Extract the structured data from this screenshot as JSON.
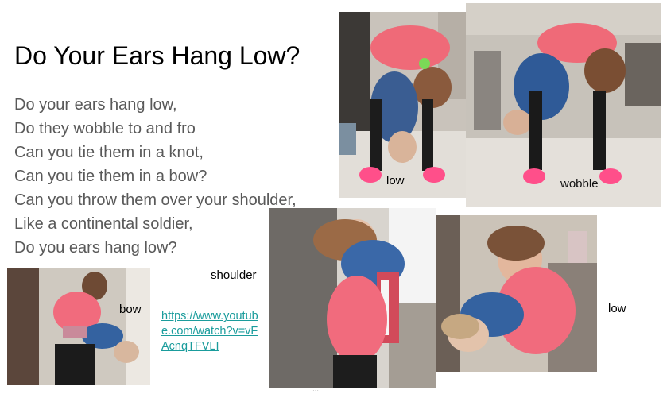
{
  "slide": {
    "title": "Do Your Ears Hang Low?",
    "lyrics": [
      "Do your ears hang low,",
      "Do they wobble to and fro",
      "Can you tie them in a knot,",
      "Can you tie them in a bow?",
      "Can you throw them over your shoulder,",
      "Like a continental soldier,",
      "Do you ears hang low?"
    ],
    "link": "https://www.youtube.com/watch?v=vFAcnqTFVLI",
    "captions": {
      "low_top": "low",
      "wobble": "wobble",
      "bow": "bow",
      "shoulder": "shoulder",
      "low_bottom": "low"
    },
    "marker": "···"
  }
}
